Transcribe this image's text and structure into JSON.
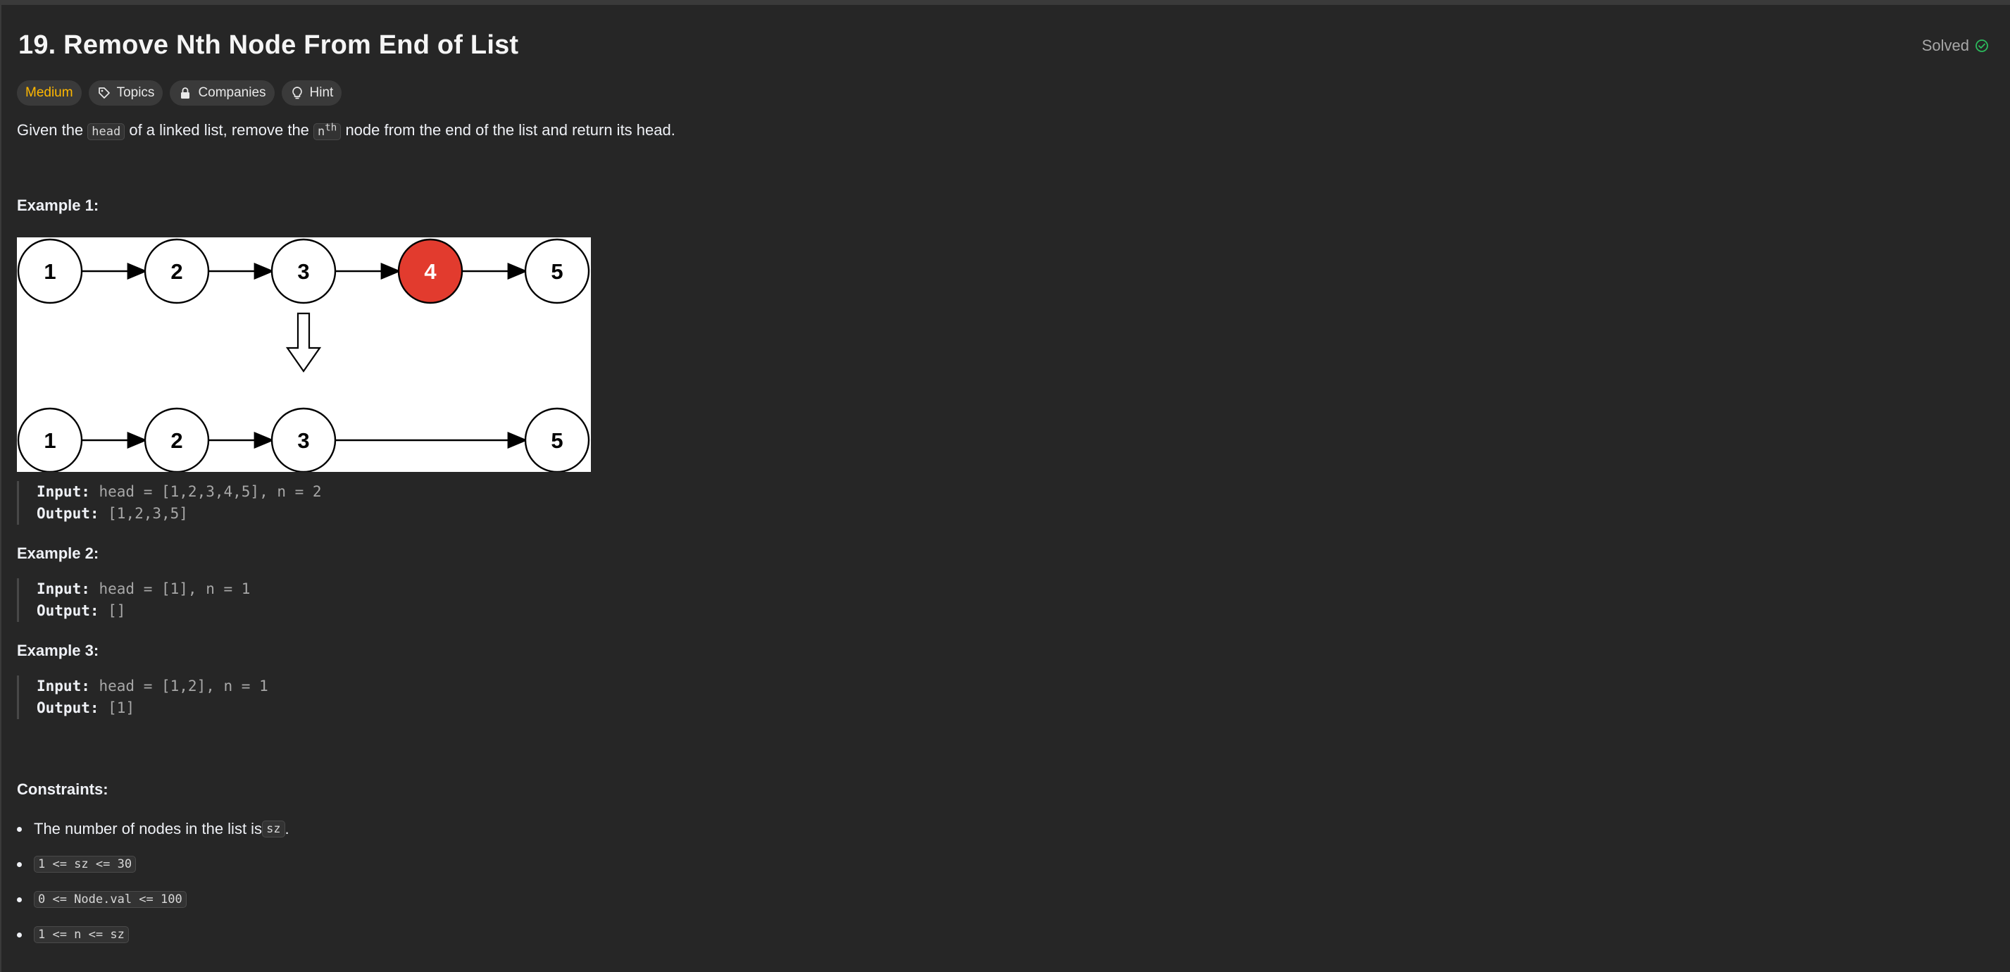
{
  "problem": {
    "title": "19. Remove Nth Node From End of List",
    "status": "Solved",
    "tags": {
      "difficulty": "Medium",
      "topics": "Topics",
      "companies": "Companies",
      "hint": "Hint"
    },
    "description": {
      "part1": "Given the ",
      "code_head": "head",
      "part2": " of a linked list, remove the ",
      "code_n": "n",
      "code_th": "th",
      "part3": " node from the end of the list and return its head."
    }
  },
  "diagram": {
    "top_nodes": [
      "1",
      "2",
      "3",
      "4",
      "5"
    ],
    "removed_node": "4",
    "bottom_nodes": [
      "1",
      "2",
      "3",
      "5"
    ],
    "highlight_color": "#e23b2e"
  },
  "examples": [
    {
      "heading": "Example 1:",
      "input_label": "Input:",
      "input_value": " head = [1,2,3,4,5], n = 2",
      "output_label": "Output:",
      "output_value": " [1,2,3,5]"
    },
    {
      "heading": "Example 2:",
      "input_label": "Input:",
      "input_value": " head = [1], n = 1",
      "output_label": "Output:",
      "output_value": " []"
    },
    {
      "heading": "Example 3:",
      "input_label": "Input:",
      "input_value": " head = [1,2], n = 1",
      "output_label": "Output:",
      "output_value": " [1]"
    }
  ],
  "constraints": {
    "heading": "Constraints:",
    "item0_text": "The number of nodes in the list is ",
    "item0_code": "sz",
    "item0_end": ".",
    "item1_code": "1 <= sz <= 30",
    "item2_code": "0 <= Node.val <= 100",
    "item3_code": "1 <= n <= sz"
  },
  "colors": {
    "accent_medium": "#ffb800",
    "solved_check": "#2cbb5d"
  }
}
